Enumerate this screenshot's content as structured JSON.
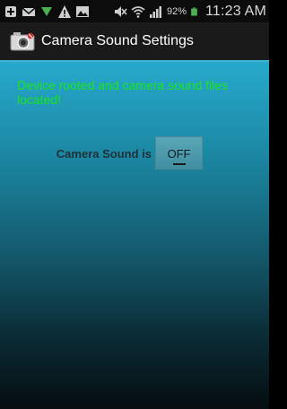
{
  "statusbar": {
    "battery_percent": "92%",
    "time": "11:23 AM",
    "icons": [
      "plus-icon",
      "mail-icon",
      "signal-arrows-icon",
      "warning-icon",
      "gallery-icon",
      "mute-icon",
      "wifi-icon",
      "cell-signal-icon",
      "battery-icon"
    ]
  },
  "app": {
    "title": "Camera Sound Settings"
  },
  "main": {
    "status_message": "Device rooted and camera sound files located!",
    "camera_sound_label": "Camera Sound is",
    "toggle_label": "OFF"
  },
  "colors": {
    "status_message": "#19e619",
    "accent": "#27a9cc"
  }
}
